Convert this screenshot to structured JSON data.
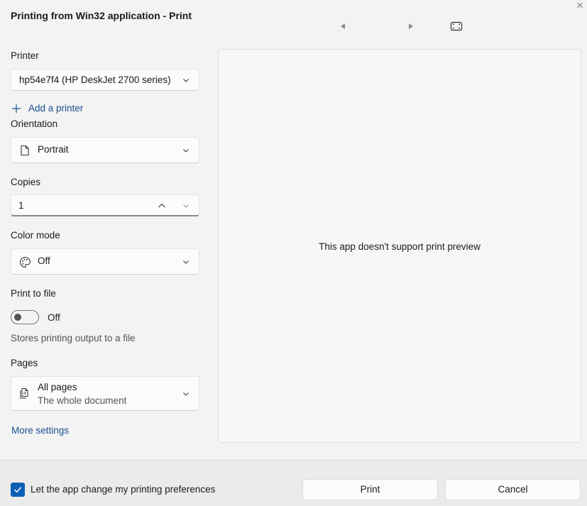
{
  "window": {
    "title": "Printing from Win32 application - Print",
    "close_glyph": "✕"
  },
  "icons": {
    "close": "close-icon",
    "prev_page": "caret-left-icon",
    "next_page": "caret-right-icon",
    "fit": "fit-to-window-icon",
    "add": "plus-icon",
    "orientation": "page-icon",
    "color": "palette-icon",
    "pages": "pages-icon",
    "dropdown": "chevron-down-icon",
    "increment": "chevron-up-icon",
    "checkbox": "checkmark-icon"
  },
  "printer": {
    "label": "Printer",
    "selected": "hp54e7f4 (HP DeskJet 2700 series)",
    "add_link": "Add a printer"
  },
  "orientation": {
    "label": "Orientation",
    "selected": "Portrait"
  },
  "copies": {
    "label": "Copies",
    "value": "1"
  },
  "color_mode": {
    "label": "Color mode",
    "selected": "Off"
  },
  "print_to_file": {
    "label": "Print to file",
    "state": "Off",
    "on": false,
    "description": "Stores printing output to a file"
  },
  "pages": {
    "label": "Pages",
    "selected": "All pages",
    "selected_sub": "The whole document"
  },
  "more_settings": "More settings",
  "preview": {
    "message": "This app doesn't support print preview"
  },
  "footer": {
    "checkbox_label": "Let the app change my printing preferences",
    "checkbox_checked": true,
    "print_button": "Print",
    "cancel_button": "Cancel"
  },
  "colors": {
    "accent": "#0a5fb4",
    "link": "#1a4f8f",
    "background": "#f3f3f3"
  }
}
